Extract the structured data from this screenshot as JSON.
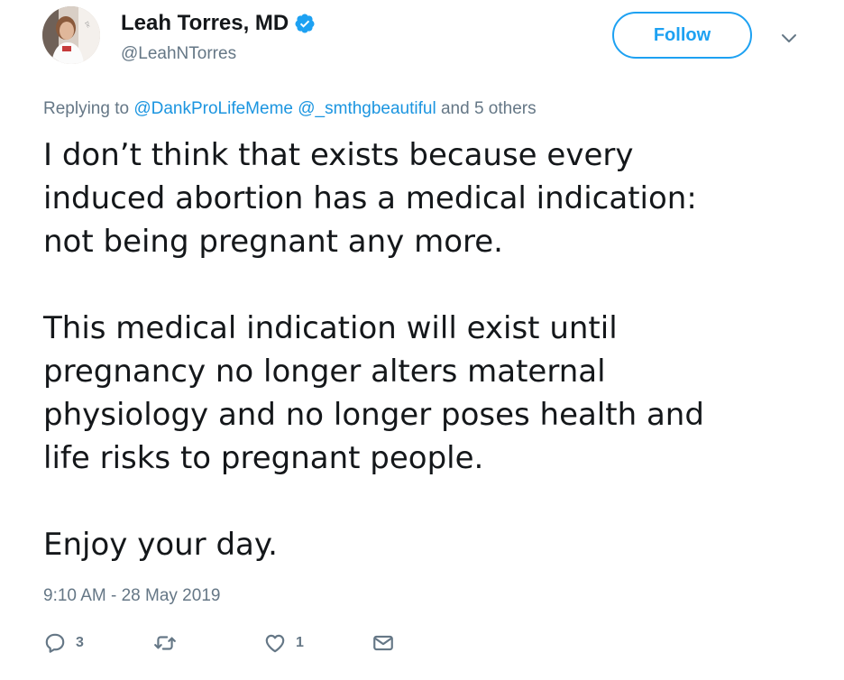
{
  "author": {
    "name": "Leah Torres, MD",
    "handle": "@LeahNTorres",
    "verified": true
  },
  "follow_label": "Follow",
  "reply_context": {
    "prefix": "Replying to",
    "mentions": [
      "@DankProLifeMeme",
      "@_smthgbeautiful"
    ],
    "suffix": "and 5 others"
  },
  "tweet": {
    "paragraphs": [
      "I don’t think that exists because every\ninduced abortion has a medical indication:\nnot being pregnant any more.",
      "This medical indication will exist until\npregnancy no longer alters maternal\nphysiology and no longer poses health and\nlife risks to pregnant people.",
      "Enjoy your day."
    ]
  },
  "timestamp": "9:10 AM - 28 May 2019",
  "actions": {
    "reply_count": "3",
    "retweet_count": "",
    "like_count": "1"
  },
  "colors": {
    "accent": "#1da1f2",
    "link": "#1b95e0",
    "muted": "#657786",
    "text": "#14171a"
  },
  "icons": {
    "verified": "verified-badge-icon",
    "caret": "chevron-down-icon",
    "reply": "reply-icon",
    "retweet": "retweet-icon",
    "like": "heart-icon",
    "dm": "envelope-icon"
  }
}
